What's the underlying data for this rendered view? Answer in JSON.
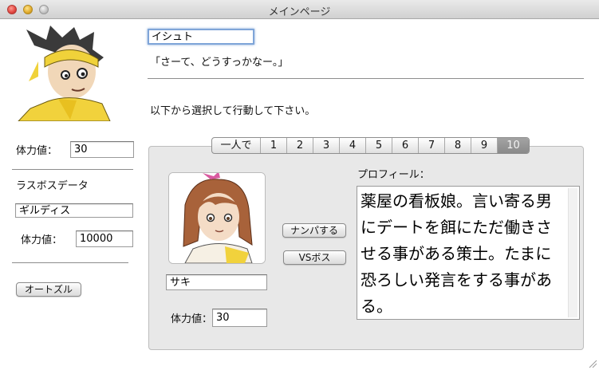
{
  "window": {
    "title": "メインページ"
  },
  "player": {
    "name": "イシュト",
    "dialogue": "「さーて、どうすっかなー。」",
    "hp_label": "体力値：",
    "hp_value": "30"
  },
  "instruction": "以下から選択して行動して下さい。",
  "boss": {
    "section_label": "ラスボスデータ",
    "name": "ギルディス",
    "hp_label": "体力値：",
    "hp_value": "10000"
  },
  "auto_button": "オートズル",
  "tabs": [
    "一人で",
    "1",
    "2",
    "3",
    "4",
    "5",
    "6",
    "7",
    "8",
    "9",
    "10"
  ],
  "active_tab_index": 10,
  "target": {
    "name": "サキ",
    "hp_label": "体力値：",
    "hp_value": "30",
    "profile_label": "プロフィール：",
    "profile_text": "薬屋の看板娘。言い寄る男にデートを餌にただ働きさせる事がある策士。たまに恐ろしい発言をする事がある。",
    "action_buttons": [
      "ナンパする",
      "VSボス"
    ]
  },
  "colors": {
    "focus_ring": "#7fa5d8",
    "active_tab": "#8a8a8a",
    "panel_bg": "#e8e8e8"
  }
}
